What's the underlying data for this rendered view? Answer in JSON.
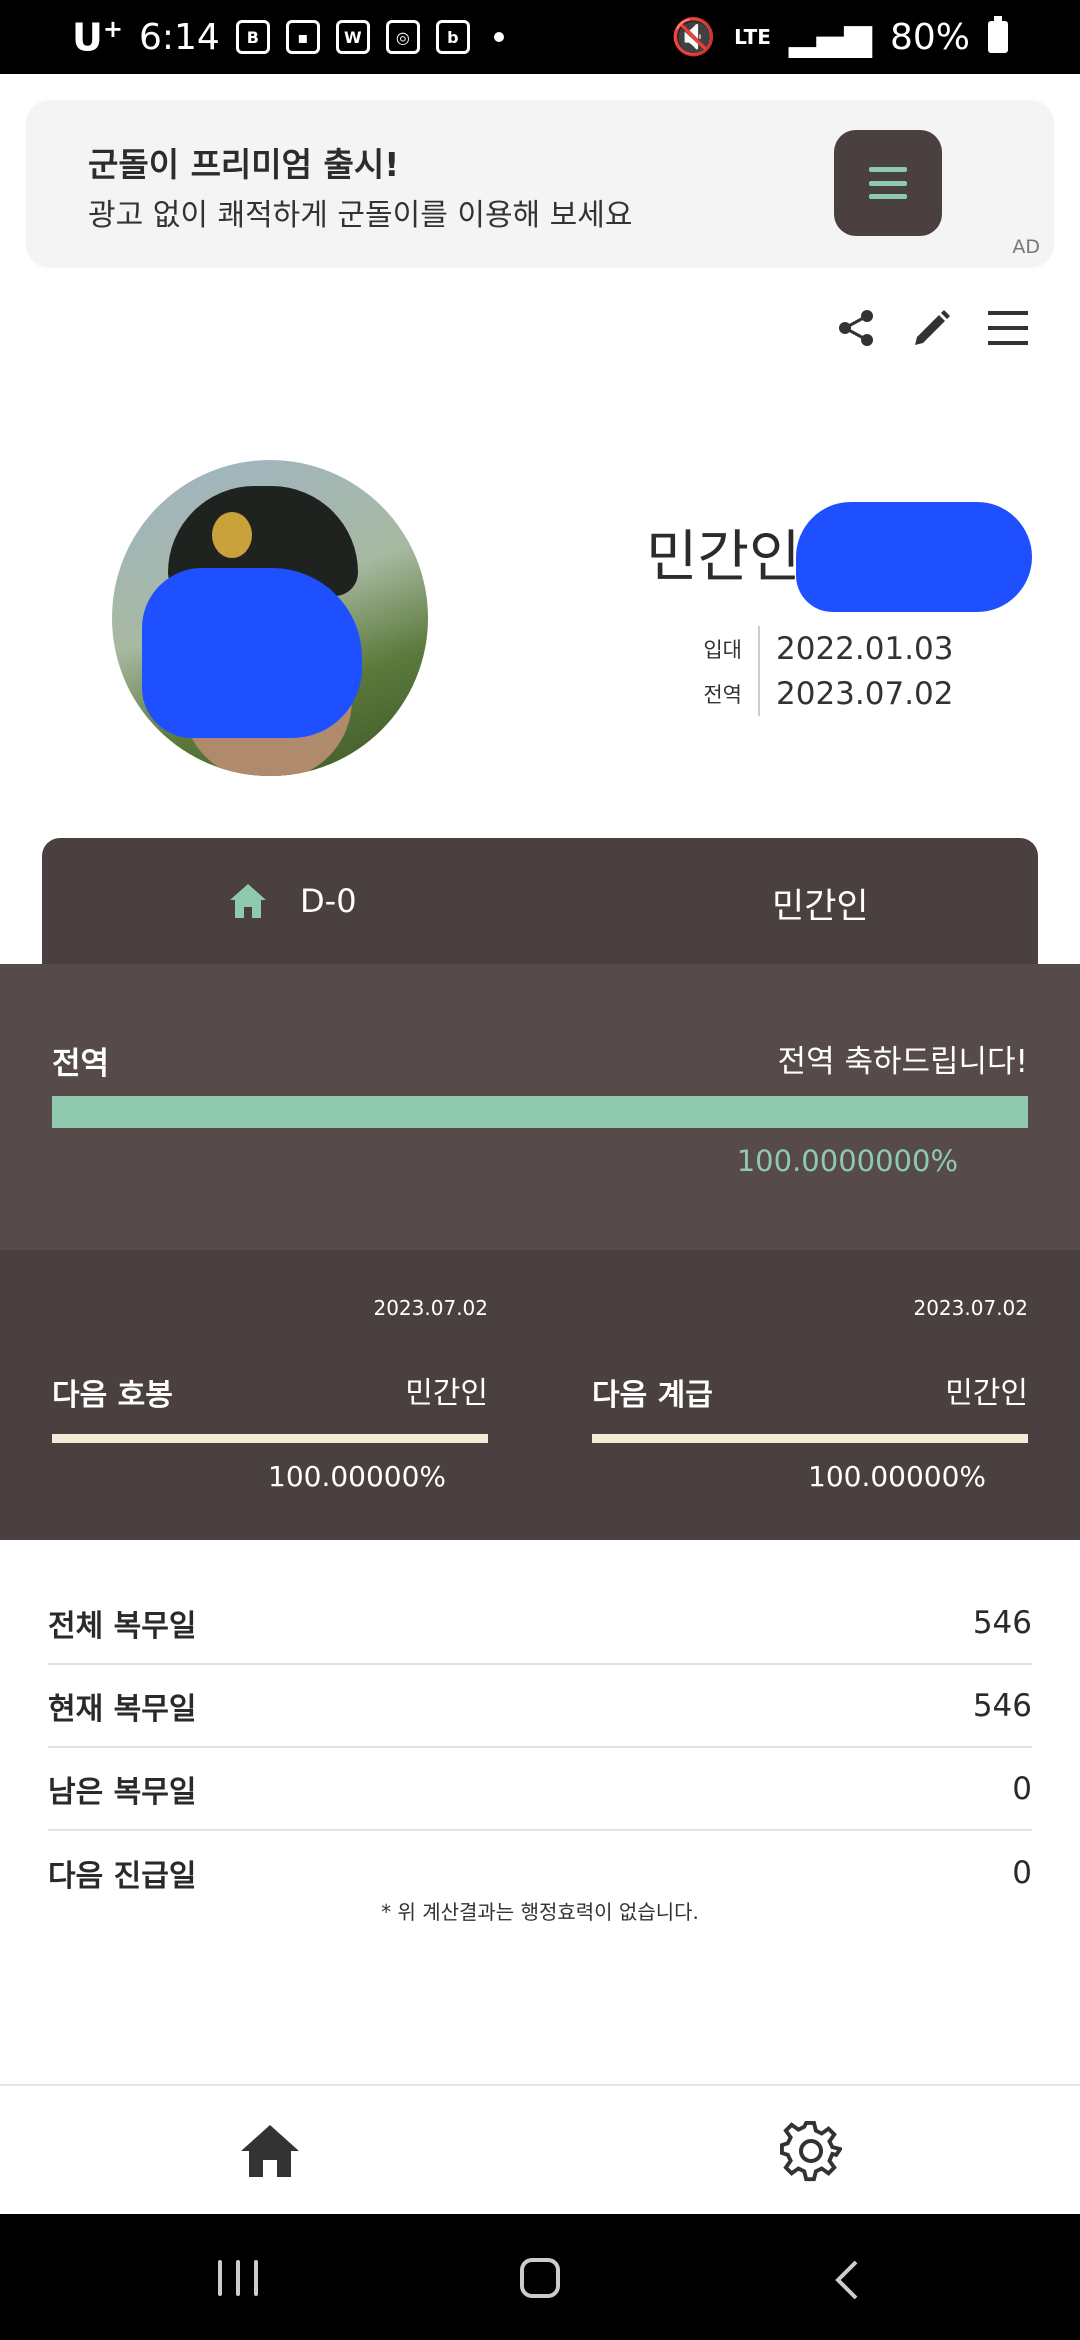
{
  "status_bar": {
    "carrier": "U",
    "carrier_sup": "+",
    "time": "6:14",
    "network": "LTE",
    "battery": "80%"
  },
  "ad": {
    "title": "군돌이 프리미엄 출시!",
    "subtitle": "광고 없이 쾌적하게 군돌이를 이용해 보세요",
    "tag": "AD"
  },
  "profile": {
    "name": "민간인",
    "enlist_label": "입대",
    "enlist_date": "2022.01.03",
    "discharge_label": "전역",
    "discharge_date": "2023.07.02"
  },
  "dday": {
    "countdown": "D-0",
    "status": "민간인"
  },
  "discharge_progress": {
    "label": "전역",
    "message": "전역 축하드립니다!",
    "percent_text": "100.0000000%",
    "fraction": 1.0
  },
  "next_pay": {
    "date": "2023.07.02",
    "title": "다음 호봉",
    "value": "민간인",
    "percent_text": "100.00000%",
    "fraction": 1.0
  },
  "next_rank": {
    "date": "2023.07.02",
    "title": "다음 계급",
    "value": "민간인",
    "percent_text": "100.00000%",
    "fraction": 1.0
  },
  "stats": [
    {
      "label": "전체 복무일",
      "value": "546"
    },
    {
      "label": "현재 복무일",
      "value": "546"
    },
    {
      "label": "남은 복무일",
      "value": "0"
    },
    {
      "label": "다음 진급일",
      "value": "0"
    }
  ],
  "note": "* 위 계산결과는 행정효력이 없습니다.",
  "colors": {
    "accent": "#8fc9ae",
    "dark_brown": "#4a4040",
    "mid_brown": "#564a4a",
    "cream": "#f4ecd8"
  },
  "icons": {
    "top_actions": [
      "share-icon",
      "edit-icon",
      "menu-icon"
    ],
    "bottom_nav": [
      "home-icon",
      "settings-icon"
    ]
  }
}
